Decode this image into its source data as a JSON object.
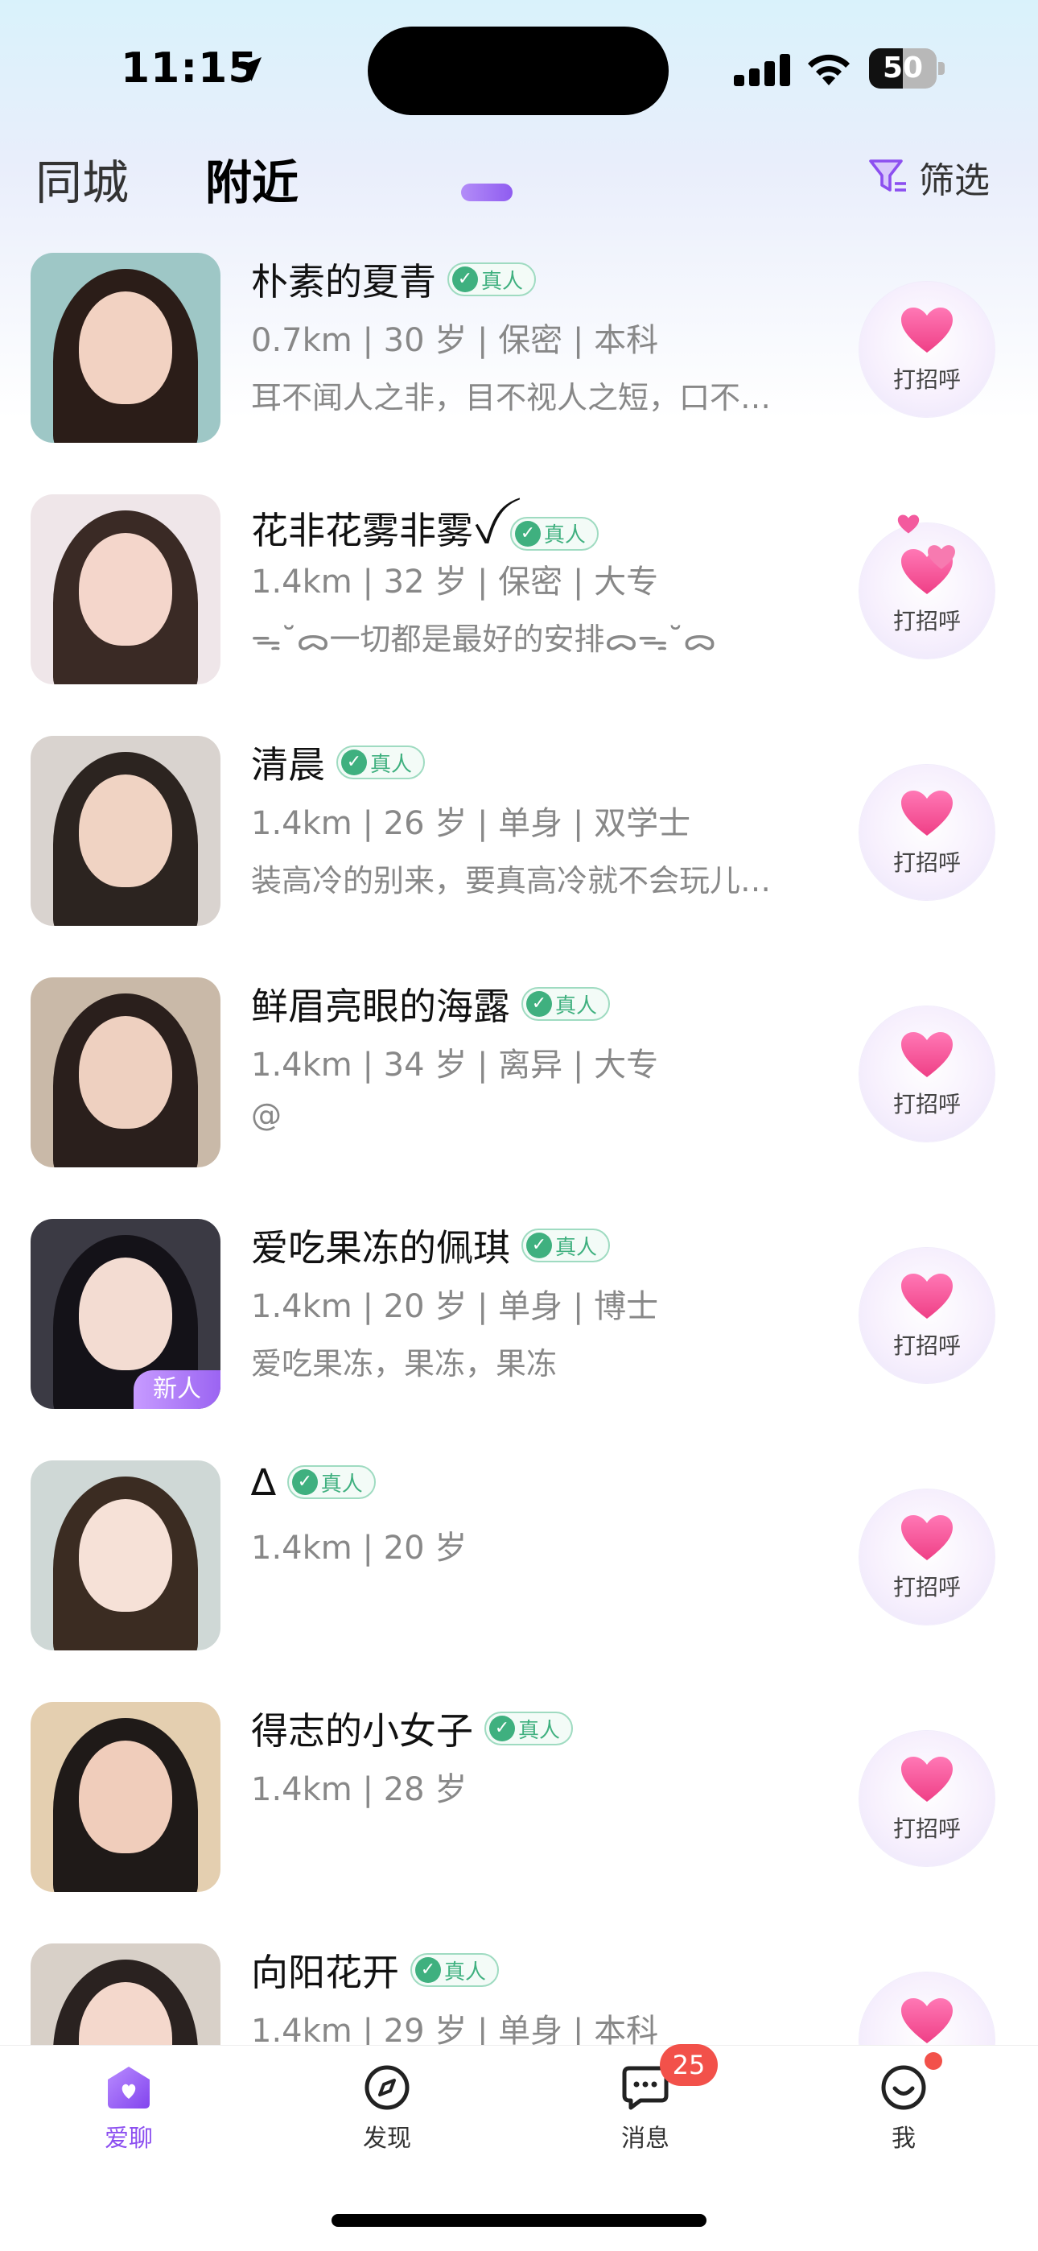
{
  "status": {
    "time": "11:15",
    "battery": "50",
    "battery_level": 0.5
  },
  "header": {
    "tabs": [
      {
        "label": "同城",
        "active": false
      },
      {
        "label": "附近",
        "active": true
      }
    ],
    "filter_label": "筛选"
  },
  "verified_label": "真人",
  "greet_label": "打招呼",
  "users": [
    {
      "name": "朴素的夏青",
      "meta": "0.7km | 30 岁 | 保密 | 本科",
      "bio": "耳不闻人之非，目不视人之短，口不…",
      "new": false
    },
    {
      "name": "花非花雾非雾ꪜ",
      "meta": "1.4km | 32 岁 | 保密 | 大专",
      "bio": "ᯓ˘̆ᯅ一切都是最好的安排ᯅᯓ˘̆ᯅ",
      "new": false
    },
    {
      "name": "清晨",
      "meta": "1.4km | 26 岁 | 单身 | 双学士",
      "bio": "装高冷的别来，要真高冷就不会玩儿…",
      "new": false
    },
    {
      "name": "鲜眉亮眼的海露",
      "meta": "1.4km | 34 岁 | 离异 | 大专",
      "bio": "@",
      "new": false
    },
    {
      "name": "爱吃果冻的佩琪",
      "meta": "1.4km | 20 岁 | 单身 | 博士",
      "bio": "爱吃果冻，果冻，果冻",
      "new": true
    },
    {
      "name": "∆",
      "meta": "1.4km | 20 岁",
      "bio": "",
      "new": false
    },
    {
      "name": "得志的小女子",
      "meta": "1.4km | 28 岁",
      "bio": "",
      "new": false
    },
    {
      "name": "向阳花开",
      "meta": "1.4km | 29 岁 | 单身 | 本科",
      "bio": "",
      "new": false
    }
  ],
  "new_badge_label": "新人",
  "nav": {
    "items": [
      {
        "label": "爱聊",
        "icon": "home-heart-icon",
        "active": true
      },
      {
        "label": "发现",
        "icon": "compass-icon",
        "active": false
      },
      {
        "label": "消息",
        "icon": "chat-bubble-icon",
        "active": false,
        "badge": "25"
      },
      {
        "label": "我",
        "icon": "smile-face-icon",
        "active": false,
        "dot": true
      }
    ]
  },
  "colors": {
    "accent": "#8c4ff0",
    "heart": "#f0549a",
    "verified": "#3fb07f",
    "badge": "#f2514a"
  }
}
